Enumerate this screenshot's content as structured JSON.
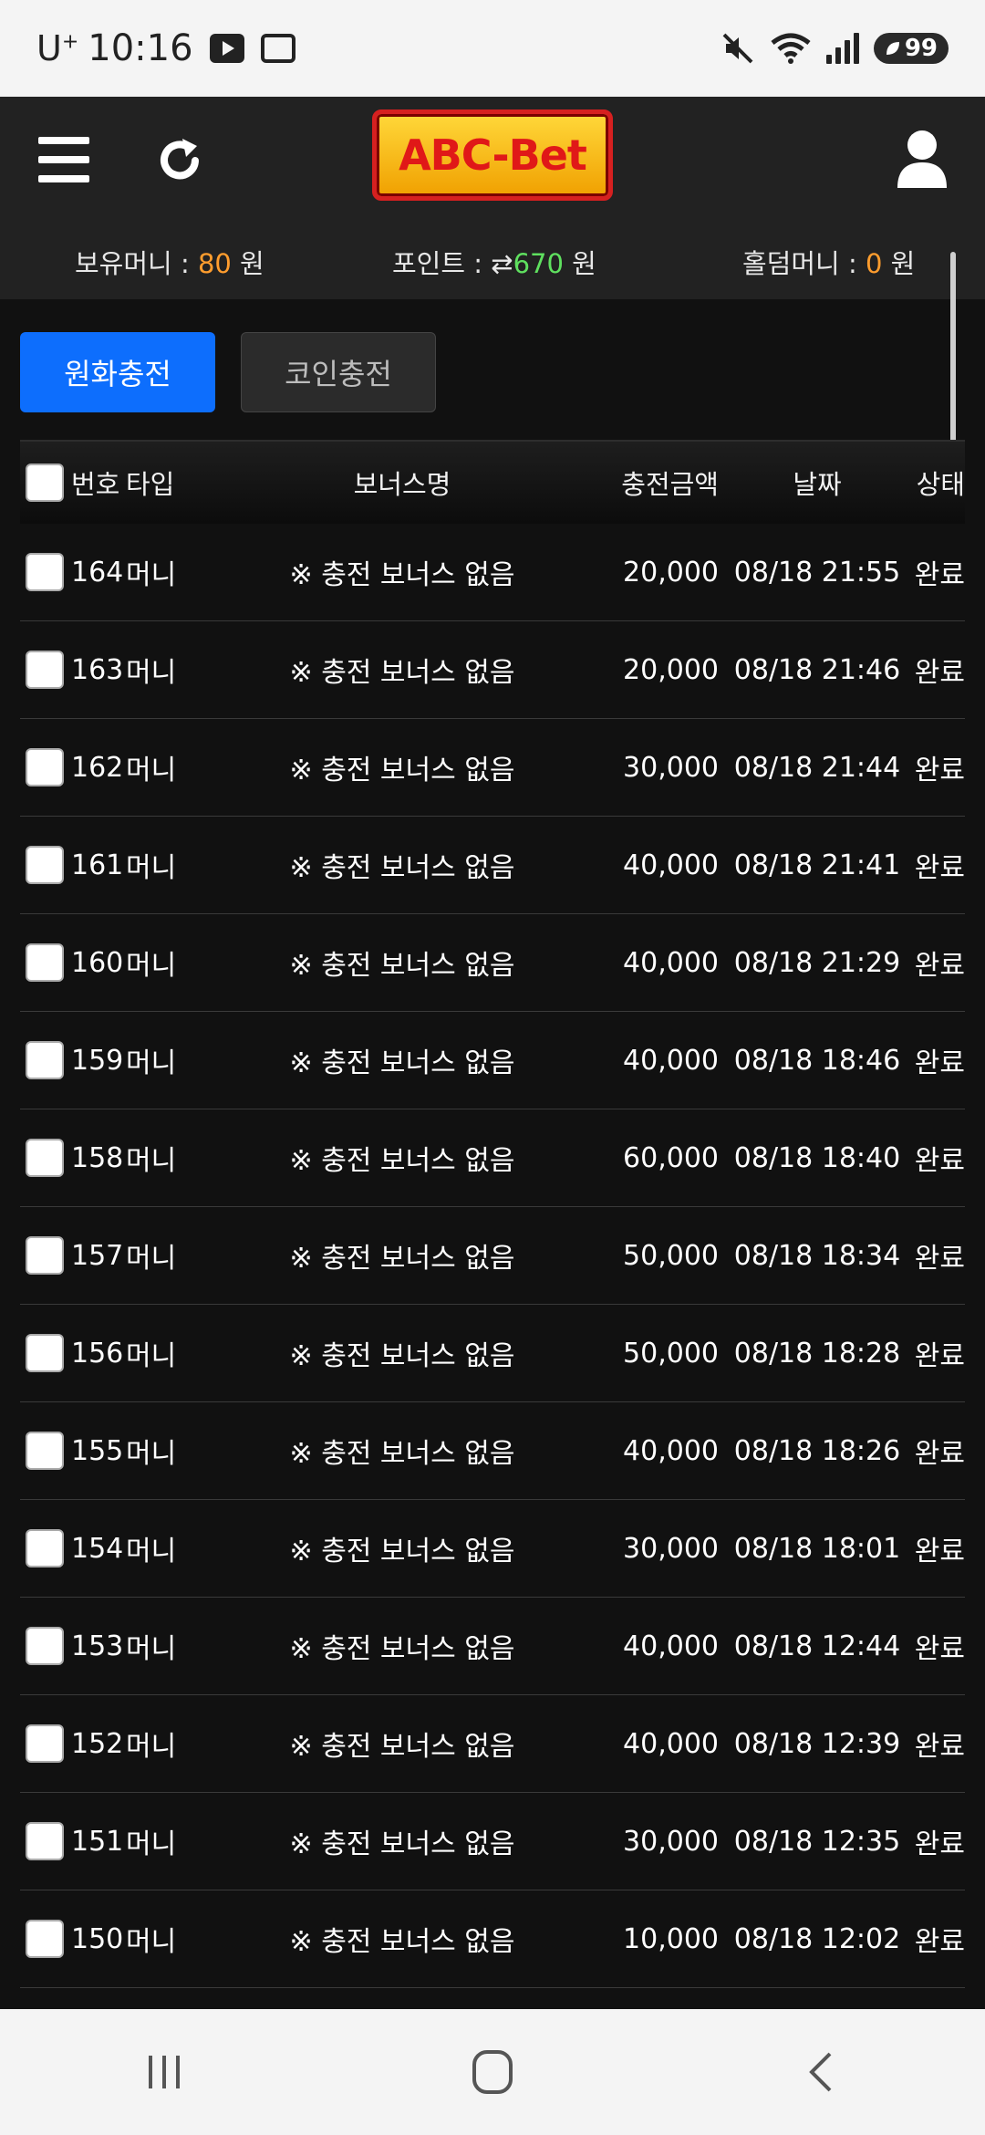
{
  "status_bar": {
    "carrier": "U",
    "carrier_sup": "+",
    "time": "10:16",
    "battery": "99"
  },
  "header": {
    "logo": "ABC-Bet",
    "balance": {
      "money_label": "보유머니 : ",
      "money_value": "80",
      "money_unit": " 원",
      "point_label": "포인트 : ",
      "point_icon": "⇄",
      "point_value": "670",
      "point_unit": " 원",
      "holdem_label": "홀덤머니 : ",
      "holdem_value": "0",
      "holdem_unit": " 원"
    }
  },
  "tabs": [
    {
      "label": "원화충전",
      "active": true
    },
    {
      "label": "코인충전",
      "active": false
    }
  ],
  "table": {
    "headers": {
      "no": "번호",
      "type": "타입",
      "bonus": "보너스명",
      "amount": "충전금액",
      "date": "날짜",
      "status": "상태"
    },
    "rows": [
      {
        "no": "164",
        "type": "머니",
        "bonus": "※ 충전 보너스 없음",
        "amount": "20,000",
        "date": "08/18 21:55",
        "status": "완료"
      },
      {
        "no": "163",
        "type": "머니",
        "bonus": "※ 충전 보너스 없음",
        "amount": "20,000",
        "date": "08/18 21:46",
        "status": "완료"
      },
      {
        "no": "162",
        "type": "머니",
        "bonus": "※ 충전 보너스 없음",
        "amount": "30,000",
        "date": "08/18 21:44",
        "status": "완료"
      },
      {
        "no": "161",
        "type": "머니",
        "bonus": "※ 충전 보너스 없음",
        "amount": "40,000",
        "date": "08/18 21:41",
        "status": "완료"
      },
      {
        "no": "160",
        "type": "머니",
        "bonus": "※ 충전 보너스 없음",
        "amount": "40,000",
        "date": "08/18 21:29",
        "status": "완료"
      },
      {
        "no": "159",
        "type": "머니",
        "bonus": "※ 충전 보너스 없음",
        "amount": "40,000",
        "date": "08/18 18:46",
        "status": "완료"
      },
      {
        "no": "158",
        "type": "머니",
        "bonus": "※ 충전 보너스 없음",
        "amount": "60,000",
        "date": "08/18 18:40",
        "status": "완료"
      },
      {
        "no": "157",
        "type": "머니",
        "bonus": "※ 충전 보너스 없음",
        "amount": "50,000",
        "date": "08/18 18:34",
        "status": "완료"
      },
      {
        "no": "156",
        "type": "머니",
        "bonus": "※ 충전 보너스 없음",
        "amount": "50,000",
        "date": "08/18 18:28",
        "status": "완료"
      },
      {
        "no": "155",
        "type": "머니",
        "bonus": "※ 충전 보너스 없음",
        "amount": "40,000",
        "date": "08/18 18:26",
        "status": "완료"
      },
      {
        "no": "154",
        "type": "머니",
        "bonus": "※ 충전 보너스 없음",
        "amount": "30,000",
        "date": "08/18 18:01",
        "status": "완료"
      },
      {
        "no": "153",
        "type": "머니",
        "bonus": "※ 충전 보너스 없음",
        "amount": "40,000",
        "date": "08/18 12:44",
        "status": "완료"
      },
      {
        "no": "152",
        "type": "머니",
        "bonus": "※ 충전 보너스 없음",
        "amount": "40,000",
        "date": "08/18 12:39",
        "status": "완료"
      },
      {
        "no": "151",
        "type": "머니",
        "bonus": "※ 충전 보너스 없음",
        "amount": "30,000",
        "date": "08/18 12:35",
        "status": "완료"
      },
      {
        "no": "150",
        "type": "머니",
        "bonus": "※ 충전 보너스 없음",
        "amount": "10,000",
        "date": "08/18 12:02",
        "status": "완료"
      }
    ]
  },
  "colors": {
    "accent_blue": "#0d6efd",
    "money_orange": "#ff9d2e",
    "point_green": "#5fe05f"
  }
}
